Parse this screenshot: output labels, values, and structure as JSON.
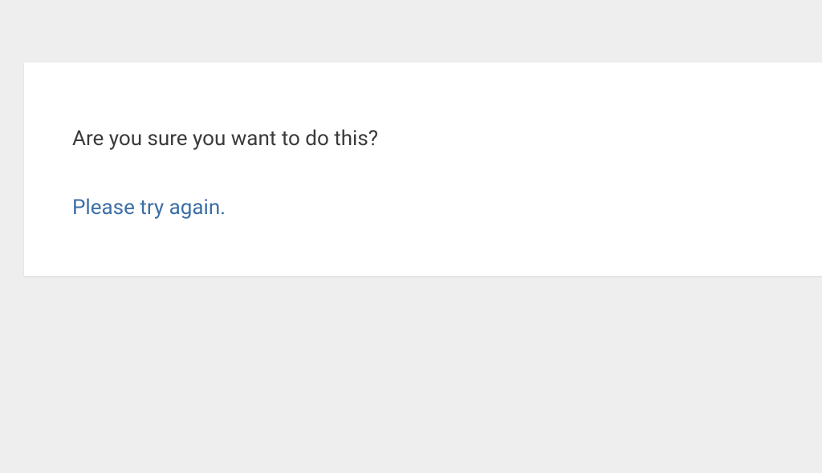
{
  "dialog": {
    "message": "Are you sure you want to do this?",
    "retry_label": "Please try again."
  }
}
